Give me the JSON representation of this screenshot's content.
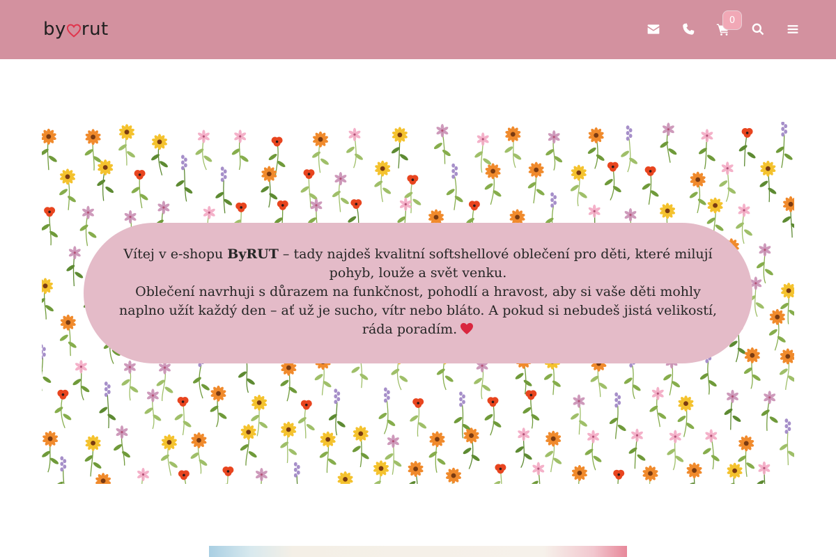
{
  "header": {
    "logo": {
      "text_left": "by",
      "text_right": "rut",
      "heart_color": "#e0344c"
    },
    "bg_color": "#d3919f",
    "icons": [
      {
        "name": "email-icon"
      },
      {
        "name": "phone-icon"
      },
      {
        "name": "cart-icon"
      },
      {
        "name": "search-icon"
      },
      {
        "name": "menu-icon"
      }
    ],
    "cart_count": "0"
  },
  "hero": {
    "bubble_color": "#e4bbc8",
    "line1_pre": "Vítej v e-shopu ",
    "brand": "ByRUT",
    "line1_post": " – tady najdeš kvalitní softshellové oblečení pro děti, které milují pohyb, louže a svět venku.",
    "line2": "Oblečení navrhuji s důrazem na funkčnost, pohodlí a hravost, aby si vaše děti mohly naplno užít každý den – ať už je sucho, vítr nebo bláto. A pokud si nebudeš jistá velikostí, ráda poradím.",
    "heart_emoji": "heart-icon"
  }
}
